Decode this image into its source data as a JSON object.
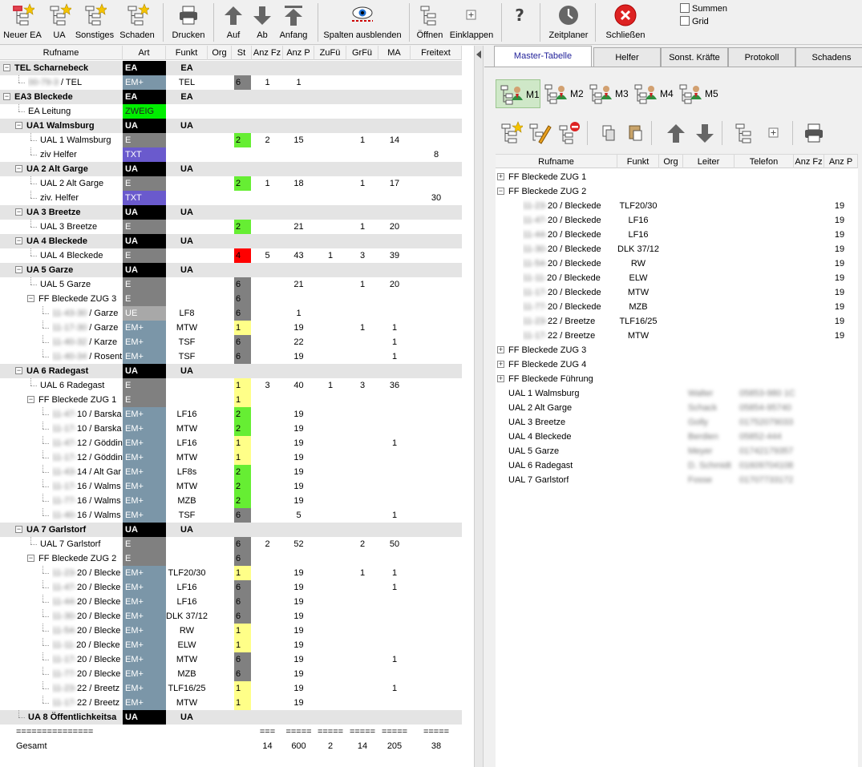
{
  "toolbar": {
    "buttons": [
      {
        "label": "Neuer EA",
        "icon": "tree-new-star-icon"
      },
      {
        "label": "UA",
        "icon": "tree-star-icon"
      },
      {
        "label": "Sonstiges",
        "icon": "tree-star-icon"
      },
      {
        "label": "Schaden",
        "icon": "tree-star-icon"
      },
      {
        "label": "Drucken",
        "icon": "printer-icon"
      },
      {
        "label": "Auf",
        "icon": "arrow-up-icon"
      },
      {
        "label": "Ab",
        "icon": "arrow-down-icon"
      },
      {
        "label": "Anfang",
        "icon": "arrow-top-icon"
      },
      {
        "label": "Spalten ausblenden",
        "icon": "eye-icon"
      },
      {
        "label": "Öffnen",
        "icon": "tree-expand-icon"
      },
      {
        "label": "Einklappen",
        "icon": "tree-collapse-icon"
      },
      {
        "label": "?",
        "icon": "help-icon"
      },
      {
        "label": "Zeitplaner",
        "icon": "clock-icon"
      },
      {
        "label": "Schließen",
        "icon": "close-circle-icon"
      }
    ],
    "summen_label": "Summen",
    "grid_label": "Grid"
  },
  "left": {
    "columns": [
      "Rufname",
      "Art",
      "Funkt",
      "Org",
      "St",
      "Anz Fz",
      "Anz P",
      "ZuFü",
      "GrFü",
      "MA",
      "Freitext"
    ],
    "rows": [
      {
        "lvl": 0,
        "pm": "-",
        "group": true,
        "bold": true,
        "name": "TEL Scharnebeck",
        "art": "EA",
        "artc": "black",
        "funkt": "EA",
        "fb": true
      },
      {
        "lvl": 1,
        "blurpre": "00-79-3",
        "name": " / TEL",
        "art": "EM+",
        "artc": "blue",
        "funkt": "TEL",
        "st": "6",
        "stc": "grey",
        "fz": "1",
        "p": "1"
      },
      {
        "lvl": 0,
        "pm": "-",
        "group": true,
        "bold": true,
        "name": "EA3 Bleckede",
        "art": "EA",
        "artc": "black",
        "funkt": "EA",
        "fb": true
      },
      {
        "lvl": 1,
        "name": "EA Leitung",
        "art": "ZWEIG",
        "artc": "green"
      },
      {
        "lvl": 1,
        "pm": "-",
        "group": true,
        "bold": true,
        "name": "UA1 Walmsburg",
        "art": "UA",
        "artc": "black",
        "funkt": "UA",
        "fb": true
      },
      {
        "lvl": 2,
        "name": "UAL 1 Walmsburg",
        "art": "E",
        "artc": "grey",
        "st": "2",
        "stc": "green",
        "fz": "2",
        "p": "15",
        "gr": "1",
        "ma": "14"
      },
      {
        "lvl": 2,
        "name": "ziv Helfer",
        "art": "TXT",
        "artc": "purple",
        "frei": "8"
      },
      {
        "lvl": 1,
        "pm": "-",
        "group": true,
        "bold": true,
        "name": "UA 2 Alt Garge",
        "art": "UA",
        "artc": "black",
        "funkt": "UA",
        "fb": true
      },
      {
        "lvl": 2,
        "name": "UAL 2 Alt Garge",
        "art": "E",
        "artc": "grey",
        "st": "2",
        "stc": "green",
        "fz": "1",
        "p": "18",
        "gr": "1",
        "ma": "17"
      },
      {
        "lvl": 2,
        "name": "ziv. Helfer",
        "art": "TXT",
        "artc": "purple",
        "frei": "30"
      },
      {
        "lvl": 1,
        "pm": "-",
        "group": true,
        "bold": true,
        "name": "UA 3 Breetze",
        "art": "UA",
        "artc": "black",
        "funkt": "UA",
        "fb": true
      },
      {
        "lvl": 2,
        "name": "UAL 3 Breetze",
        "art": "E",
        "artc": "grey",
        "st": "2",
        "stc": "green",
        "p": "21",
        "gr": "1",
        "ma": "20"
      },
      {
        "lvl": 1,
        "pm": "-",
        "group": true,
        "bold": true,
        "name": "UA 4 Bleckede",
        "art": "UA",
        "artc": "black",
        "funkt": "UA",
        "fb": true
      },
      {
        "lvl": 2,
        "name": "UAL 4 Bleckede",
        "art": "E",
        "artc": "grey",
        "st": "4",
        "stc": "red",
        "fz": "5",
        "p": "43",
        "zu": "1",
        "gr": "3",
        "ma": "39"
      },
      {
        "lvl": 1,
        "pm": "-",
        "group": true,
        "bold": true,
        "name": "UA 5 Garze",
        "art": "UA",
        "artc": "black",
        "funkt": "UA",
        "fb": true
      },
      {
        "lvl": 2,
        "name": "UAL 5 Garze",
        "art": "E",
        "artc": "grey",
        "st": "6",
        "stc": "grey",
        "p": "21",
        "gr": "1",
        "ma": "20"
      },
      {
        "lvl": 2,
        "pm": "-",
        "name": "FF Bleckede ZUG 3",
        "art": "E",
        "artc": "grey",
        "st": "6",
        "stc": "grey"
      },
      {
        "lvl": 3,
        "blurpre": "11-43-30",
        "name": " / Garze",
        "art": "UE",
        "artc": "lightgrey",
        "funkt": "LF8",
        "st": "6",
        "stc": "grey",
        "p": "1"
      },
      {
        "lvl": 3,
        "blurpre": "11-17-30",
        "name": " / Garze",
        "art": "EM+",
        "artc": "blue",
        "funkt": "MTW",
        "st": "1",
        "stc": "yellow",
        "p": "19",
        "gr": "1",
        "ma": "1"
      },
      {
        "lvl": 3,
        "blurpre": "11-40-32",
        "name": " / Karze",
        "art": "EM+",
        "artc": "blue",
        "funkt": "TSF",
        "st": "6",
        "stc": "grey",
        "p": "22",
        "ma": "1"
      },
      {
        "lvl": 3,
        "blurpre": "11-40-34",
        "name": " / Rosent",
        "art": "EM+",
        "artc": "blue",
        "funkt": "TSF",
        "st": "6",
        "stc": "grey",
        "p": "19",
        "ma": "1"
      },
      {
        "lvl": 1,
        "pm": "-",
        "group": true,
        "bold": true,
        "name": "UA 6 Radegast",
        "art": "UA",
        "artc": "black",
        "funkt": "UA",
        "fb": true
      },
      {
        "lvl": 2,
        "name": "UAL 6 Radegast",
        "art": "E",
        "artc": "grey",
        "st": "1",
        "stc": "yellow",
        "fz": "3",
        "p": "40",
        "zu": "1",
        "gr": "3",
        "ma": "36"
      },
      {
        "lvl": 2,
        "pm": "-",
        "name": "FF Bleckede ZUG 1",
        "art": "E",
        "artc": "grey",
        "st": "1",
        "stc": "yellow"
      },
      {
        "lvl": 3,
        "blurpre": "11-47-",
        "name": "10 / Barska",
        "art": "EM+",
        "artc": "blue",
        "funkt": "LF16",
        "st": "2",
        "stc": "green",
        "p": "19"
      },
      {
        "lvl": 3,
        "blurpre": "11-17-",
        "name": "10 / Barska",
        "art": "EM+",
        "artc": "blue",
        "funkt": "MTW",
        "st": "2",
        "stc": "green",
        "p": "19"
      },
      {
        "lvl": 3,
        "blurpre": "11-47-",
        "name": "12 / Göddin",
        "art": "EM+",
        "artc": "blue",
        "funkt": "LF16",
        "st": "1",
        "stc": "yellow",
        "p": "19",
        "ma": "1"
      },
      {
        "lvl": 3,
        "blurpre": "11-17-",
        "name": "12 / Göddin",
        "art": "EM+",
        "artc": "blue",
        "funkt": "MTW",
        "st": "1",
        "stc": "yellow",
        "p": "19"
      },
      {
        "lvl": 3,
        "blurpre": "11-43-",
        "name": "14 / Alt Gar",
        "art": "EM+",
        "artc": "blue",
        "funkt": "LF8s",
        "st": "2",
        "stc": "green",
        "p": "19"
      },
      {
        "lvl": 3,
        "blurpre": "11-17-",
        "name": "16 / Walms",
        "art": "EM+",
        "artc": "blue",
        "funkt": "MTW",
        "st": "2",
        "stc": "green",
        "p": "19"
      },
      {
        "lvl": 3,
        "blurpre": "11-77-",
        "name": "16 / Walms",
        "art": "EM+",
        "artc": "blue",
        "funkt": "MZB",
        "st": "2",
        "stc": "green",
        "p": "19"
      },
      {
        "lvl": 3,
        "blurpre": "11-40-",
        "name": "16 / Walms",
        "art": "EM+",
        "artc": "blue",
        "funkt": "TSF",
        "st": "6",
        "stc": "grey",
        "p": "5",
        "ma": "1"
      },
      {
        "lvl": 1,
        "pm": "-",
        "group": true,
        "bold": true,
        "name": "UA 7 Garlstorf",
        "art": "UA",
        "artc": "black",
        "funkt": "UA",
        "fb": true
      },
      {
        "lvl": 2,
        "name": "UAL 7 Garlstorf",
        "art": "E",
        "artc": "grey",
        "st": "6",
        "stc": "grey",
        "fz": "2",
        "p": "52",
        "gr": "2",
        "ma": "50"
      },
      {
        "lvl": 2,
        "pm": "-",
        "name": "FF Bleckede ZUG 2",
        "art": "E",
        "artc": "grey",
        "st": "6",
        "stc": "grey"
      },
      {
        "lvl": 3,
        "blurpre": "11-23-",
        "name": "20 / Blecke",
        "art": "EM+",
        "artc": "blue",
        "funkt": "TLF20/30",
        "st": "1",
        "stc": "yellow",
        "p": "19",
        "gr": "1",
        "ma": "1"
      },
      {
        "lvl": 3,
        "blurpre": "11-47-",
        "name": "20 / Blecke",
        "art": "EM+",
        "artc": "blue",
        "funkt": "LF16",
        "st": "6",
        "stc": "grey",
        "p": "19",
        "ma": "1"
      },
      {
        "lvl": 3,
        "blurpre": "11-44-",
        "name": "20 / Blecke",
        "art": "EM+",
        "artc": "blue",
        "funkt": "LF16",
        "st": "6",
        "stc": "grey",
        "p": "19"
      },
      {
        "lvl": 3,
        "blurpre": "11-30-",
        "name": "20 / Blecke",
        "art": "EM+",
        "artc": "blue",
        "funkt": "DLK 37/12",
        "st": "6",
        "stc": "grey",
        "p": "19"
      },
      {
        "lvl": 3,
        "blurpre": "11-54-",
        "name": "20 / Blecke",
        "art": "EM+",
        "artc": "blue",
        "funkt": "RW",
        "st": "1",
        "stc": "yellow",
        "p": "19"
      },
      {
        "lvl": 3,
        "blurpre": "11-11-",
        "name": "20 / Blecke",
        "art": "EM+",
        "artc": "blue",
        "funkt": "ELW",
        "st": "1",
        "stc": "yellow",
        "p": "19"
      },
      {
        "lvl": 3,
        "blurpre": "11-17-",
        "name": "20 / Blecke",
        "art": "EM+",
        "artc": "blue",
        "funkt": "MTW",
        "st": "6",
        "stc": "grey",
        "p": "19",
        "ma": "1"
      },
      {
        "lvl": 3,
        "blurpre": "11-77-",
        "name": "20 / Blecke",
        "art": "EM+",
        "artc": "blue",
        "funkt": "MZB",
        "st": "6",
        "stc": "grey",
        "p": "19"
      },
      {
        "lvl": 3,
        "blurpre": "11-23-",
        "name": "22 / Breetz",
        "art": "EM+",
        "artc": "blue",
        "funkt": "TLF16/25",
        "st": "1",
        "stc": "yellow",
        "p": "19",
        "ma": "1"
      },
      {
        "lvl": 3,
        "blurpre": "11-17-",
        "name": "22 / Breetz",
        "art": "EM+",
        "artc": "blue",
        "funkt": "MTW",
        "st": "1",
        "stc": "yellow",
        "p": "19"
      },
      {
        "lvl": 1,
        "group": true,
        "bold": true,
        "name": "UA 8 Öffentlichkeitsa",
        "art": "UA",
        "artc": "black",
        "funkt": "UA",
        "fb": true
      },
      {
        "lvl": 0,
        "name": "===============",
        "fz": "===",
        "p": "=====",
        "zu": "=====",
        "gr": "=====",
        "ma": "=====",
        "frei": "====="
      },
      {
        "lvl": 0,
        "name": "Gesamt",
        "fz": "14",
        "p": "600",
        "zu": "2",
        "gr": "14",
        "ma": "205",
        "frei": "38"
      }
    ]
  },
  "right": {
    "tabs": [
      "Master-Tabelle",
      "Helfer",
      "Sonst. Kräfte",
      "Protokoll",
      "Schadens"
    ],
    "masters": [
      "M1",
      "M2",
      "M3",
      "M4",
      "M5"
    ],
    "columns": [
      "Rufname",
      "Funkt",
      "Org",
      "Leiter",
      "Telefon",
      "Anz Fz",
      "Anz P"
    ],
    "rows": [
      {
        "lvl": 0,
        "pm": "+",
        "name": "FF Bleckede ZUG 1"
      },
      {
        "lvl": 0,
        "pm": "-",
        "name": "FF Bleckede ZUG 2"
      },
      {
        "lvl": 1,
        "blurpre": "11-23-",
        "name": "20 / Bleckede",
        "funkt": "TLF20/30",
        "p": "19"
      },
      {
        "lvl": 1,
        "blurpre": "11-47-",
        "name": "20 / Bleckede",
        "funkt": "LF16",
        "p": "19"
      },
      {
        "lvl": 1,
        "blurpre": "11-44-",
        "name": "20 / Bleckede",
        "funkt": "LF16",
        "p": "19"
      },
      {
        "lvl": 1,
        "blurpre": "11-30-",
        "name": "20 / Bleckede",
        "funkt": "DLK 37/12",
        "p": "19"
      },
      {
        "lvl": 1,
        "blurpre": "11-54-",
        "name": "20 / Bleckede",
        "funkt": "RW",
        "p": "19"
      },
      {
        "lvl": 1,
        "blurpre": "11-11-",
        "name": "20 / Bleckede",
        "funkt": "ELW",
        "p": "19"
      },
      {
        "lvl": 1,
        "blurpre": "11-17-",
        "name": "20 / Bleckede",
        "funkt": "MTW",
        "p": "19"
      },
      {
        "lvl": 1,
        "blurpre": "11-77-",
        "name": "20 / Bleckede",
        "funkt": "MZB",
        "p": "19"
      },
      {
        "lvl": 1,
        "blurpre": "11-23-",
        "name": "22 / Breetze",
        "funkt": "TLF16/25",
        "p": "19"
      },
      {
        "lvl": 1,
        "blurpre": "11-17-",
        "name": "22 / Breetze",
        "funkt": "MTW",
        "p": "19"
      },
      {
        "lvl": 0,
        "pm": "+",
        "name": "FF Bleckede ZUG 3"
      },
      {
        "lvl": 0,
        "pm": "+",
        "name": "FF Bleckede ZUG 4"
      },
      {
        "lvl": 0,
        "pm": "+",
        "name": "FF Bleckede Führung"
      },
      {
        "lvl": 0,
        "name": "UAL 1 Walmsburg",
        "leiter": "Walter",
        "tel": "05853-980 1C"
      },
      {
        "lvl": 0,
        "name": "UAL 2 Alt Garge",
        "leiter": "Schack",
        "tel": "05854-95740"
      },
      {
        "lvl": 0,
        "name": "UAL 3 Breetze",
        "leiter": "Golly",
        "tel": "01752079033"
      },
      {
        "lvl": 0,
        "name": "UAL 4 Bleckede",
        "leiter": "Berdien",
        "tel": "05852-444"
      },
      {
        "lvl": 0,
        "name": "UAL 5 Garze",
        "leiter": "Meyer",
        "tel": "01742179357"
      },
      {
        "lvl": 0,
        "name": "UAL 6 Radegast",
        "leiter": "D. Schmidt",
        "tel": "01609704108"
      },
      {
        "lvl": 0,
        "name": "UAL 7 Garlstorf",
        "leiter": "Fosse",
        "tel": "01707733172"
      }
    ]
  },
  "colors": {
    "black": "#000000",
    "blue": "#7b96a8",
    "green": "#00ee00",
    "purple": "#6a5acd",
    "grey": "#808080",
    "lightgrey": "#a8a8a8",
    "yellow": "#ffff88",
    "red": "#ff0000",
    "st_green": "#66ee33"
  }
}
